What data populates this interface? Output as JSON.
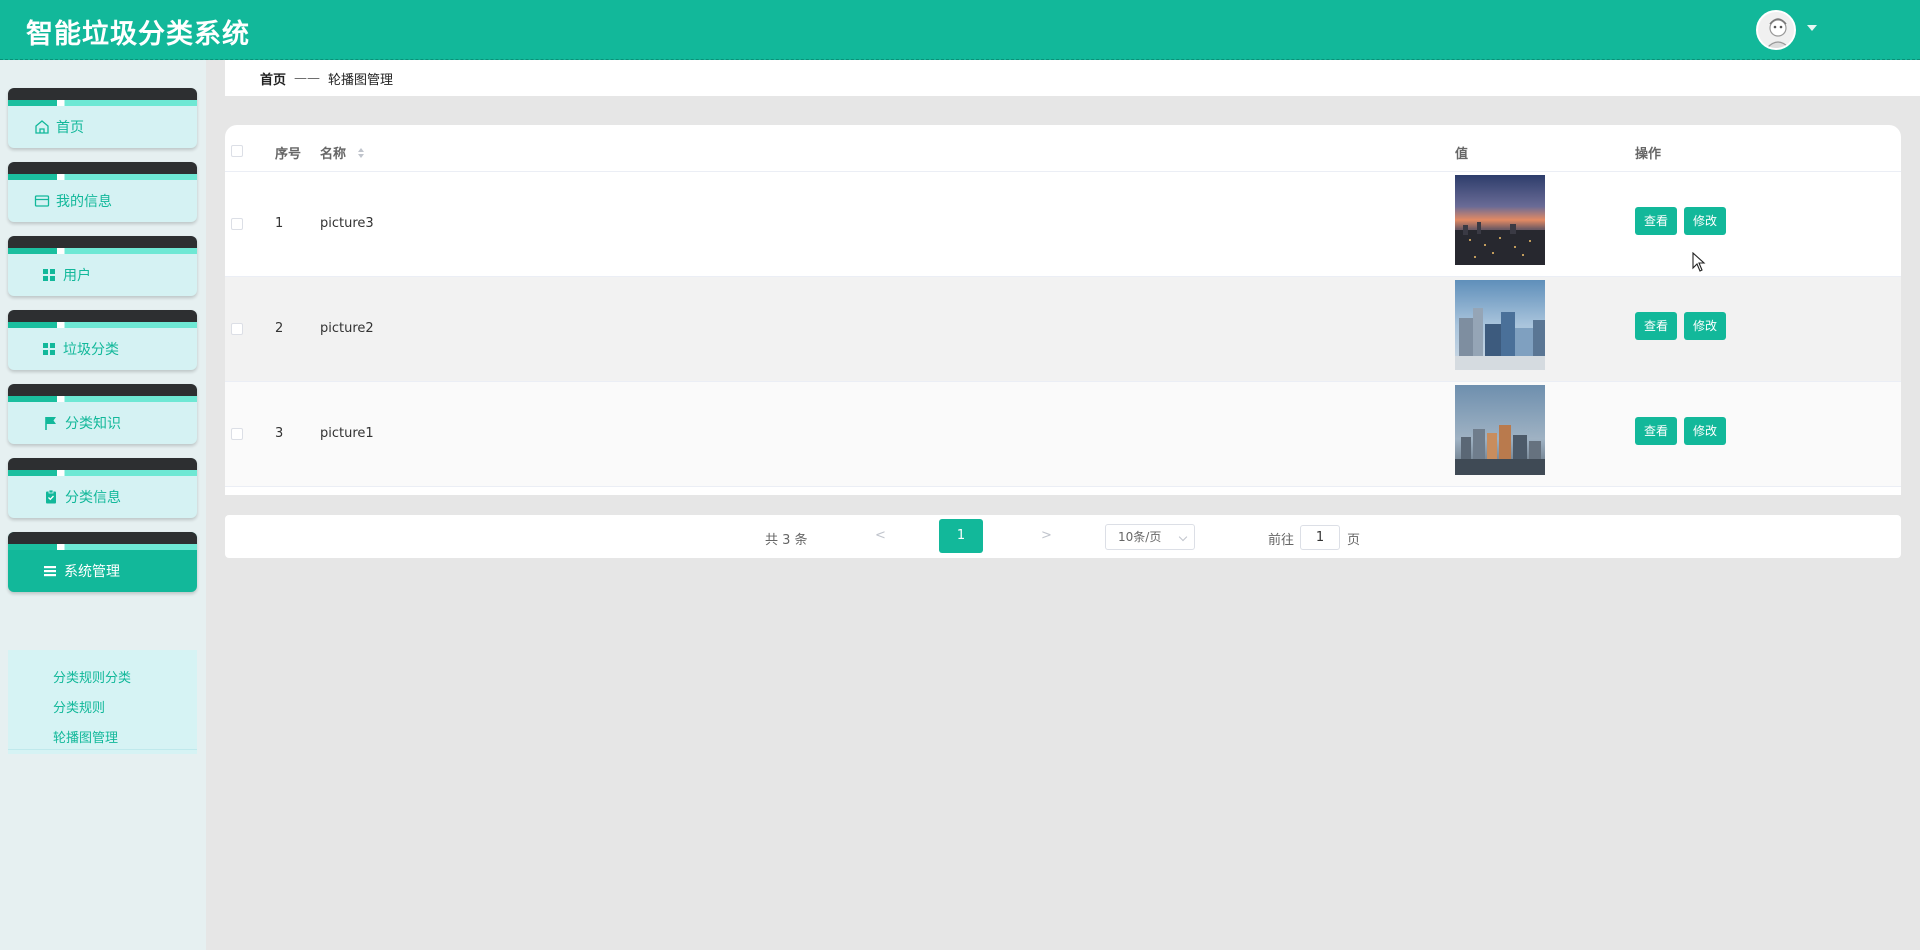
{
  "app": {
    "title": "智能垃圾分类系统"
  },
  "sidebar": {
    "items": [
      {
        "label": "首页",
        "icon": "home-icon"
      },
      {
        "label": "我的信息",
        "icon": "card-icon"
      },
      {
        "label": "用户",
        "icon": "grid-icon"
      },
      {
        "label": "垃圾分类",
        "icon": "grid-icon"
      },
      {
        "label": "分类知识",
        "icon": "flag-icon"
      },
      {
        "label": "分类信息",
        "icon": "clipboard-icon"
      },
      {
        "label": "系统管理",
        "icon": "menu-list-icon"
      }
    ],
    "submenu": [
      {
        "label": "分类规则分类"
      },
      {
        "label": "分类规则"
      },
      {
        "label": "轮播图管理"
      }
    ]
  },
  "breadcrumb": {
    "home": "首页",
    "separator": "——",
    "current": "轮播图管理"
  },
  "table": {
    "headers": {
      "index": "序号",
      "name": "名称",
      "value": "值",
      "actions": "操作"
    },
    "rows": [
      {
        "index": "1",
        "name": "picture3",
        "image": "city-sunset"
      },
      {
        "index": "2",
        "name": "picture2",
        "image": "city-buildings-day"
      },
      {
        "index": "3",
        "name": "picture1",
        "image": "city-waterfront"
      }
    ],
    "view_label": "查看",
    "edit_label": "修改"
  },
  "pagination": {
    "total": "共 3 条",
    "prev": "<",
    "current_page": "1",
    "next": ">",
    "page_size": "10条/页",
    "goto_label": "前往",
    "goto_value": "1",
    "goto_unit": "页"
  },
  "colors": {
    "primary": "#12b89a",
    "sidebar_bg": "#e6f0f1",
    "page_bg": "#e6e6e6"
  }
}
